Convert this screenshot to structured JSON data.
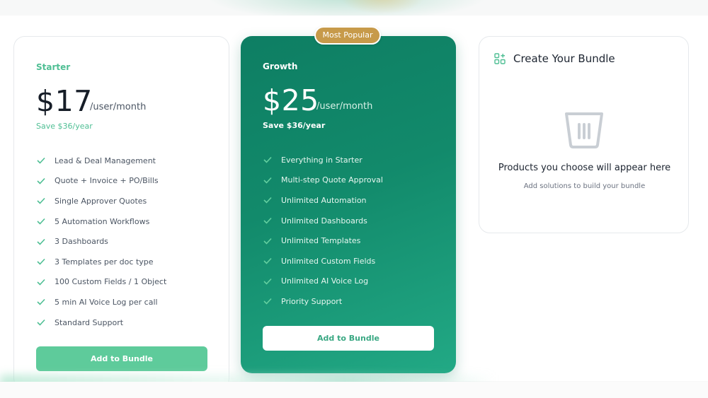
{
  "colors": {
    "accent": "#5ecb9b",
    "growth_card": "#128a6b",
    "badge": "#c79a4a"
  },
  "plans": [
    {
      "name": "Starter",
      "price": "$17",
      "per": "/user/month",
      "save": "Save $36/year",
      "features": [
        "Lead & Deal Management",
        "Quote + Invoice + PO/Bills",
        "Single Approver Quotes",
        "5 Automation Workflows",
        "3 Dashboards",
        "3 Templates per doc type",
        "100 Custom Fields / 1 Object",
        "5 min AI Voice Log per call",
        "Standard Support"
      ],
      "button": "Add to Bundle"
    },
    {
      "name": "Growth",
      "badge": "Most Popular",
      "price": "$25",
      "per": "/user/month",
      "save": "Save $36/year",
      "features": [
        "Everything in Starter",
        "Multi-step Quote Approval",
        "Unlimited Automation",
        "Unlimited Dashboards",
        "Unlimited Templates",
        "Unlimited Custom Fields",
        "Unlimited AI Voice Log",
        "Priority Support"
      ],
      "button": "Add to Bundle"
    }
  ],
  "bundle": {
    "title": "Create Your Bundle",
    "icon": "grid-plus-icon",
    "empty_icon": "basket-icon",
    "empty_title": "Products you choose will appear here",
    "empty_sub": "Add solutions to build your bundle"
  }
}
